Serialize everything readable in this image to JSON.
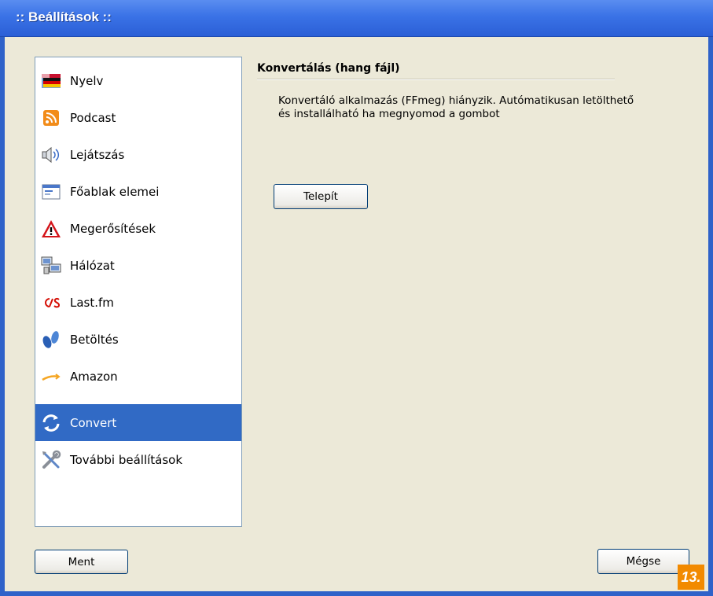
{
  "window": {
    "title": ":: Beállítások ::"
  },
  "sidebar": {
    "items": [
      {
        "label": "Nyelv",
        "icon": "flag-icon",
        "selected": false
      },
      {
        "label": "Podcast",
        "icon": "rss-icon",
        "selected": false
      },
      {
        "label": "Lejátszás",
        "icon": "speaker-icon",
        "selected": false
      },
      {
        "label": "Főablak elemei",
        "icon": "window-icon",
        "selected": false
      },
      {
        "label": "Megerősítések",
        "icon": "warning-icon",
        "selected": false
      },
      {
        "label": "Hálózat",
        "icon": "network-icon",
        "selected": false
      },
      {
        "label": "Last.fm",
        "icon": "lastfm-icon",
        "selected": false
      },
      {
        "label": "Betöltés",
        "icon": "footprints-icon",
        "selected": false
      },
      {
        "label": "Amazon",
        "icon": "amazon-icon",
        "selected": false
      },
      {
        "label": "Convert",
        "icon": "convert-icon",
        "selected": true
      },
      {
        "label": "További beállítások",
        "icon": "tools-icon",
        "selected": false
      }
    ]
  },
  "content": {
    "section_title": "Konvertálás (hang fájl)",
    "description_line1": "Konvertáló alkalmazás (FFmeg) hiányzik. Autómatikusan letölthető",
    "description_line2": "és installálható ha megnyomod a gombot",
    "install_button": "Telepít"
  },
  "footer": {
    "save_button": "Ment",
    "cancel_button": "Mégse",
    "badge": "13."
  },
  "colors": {
    "titlebar": "#3a72e6",
    "selection": "#316ac5",
    "badge": "#f28a00",
    "background": "#ece9d8"
  }
}
